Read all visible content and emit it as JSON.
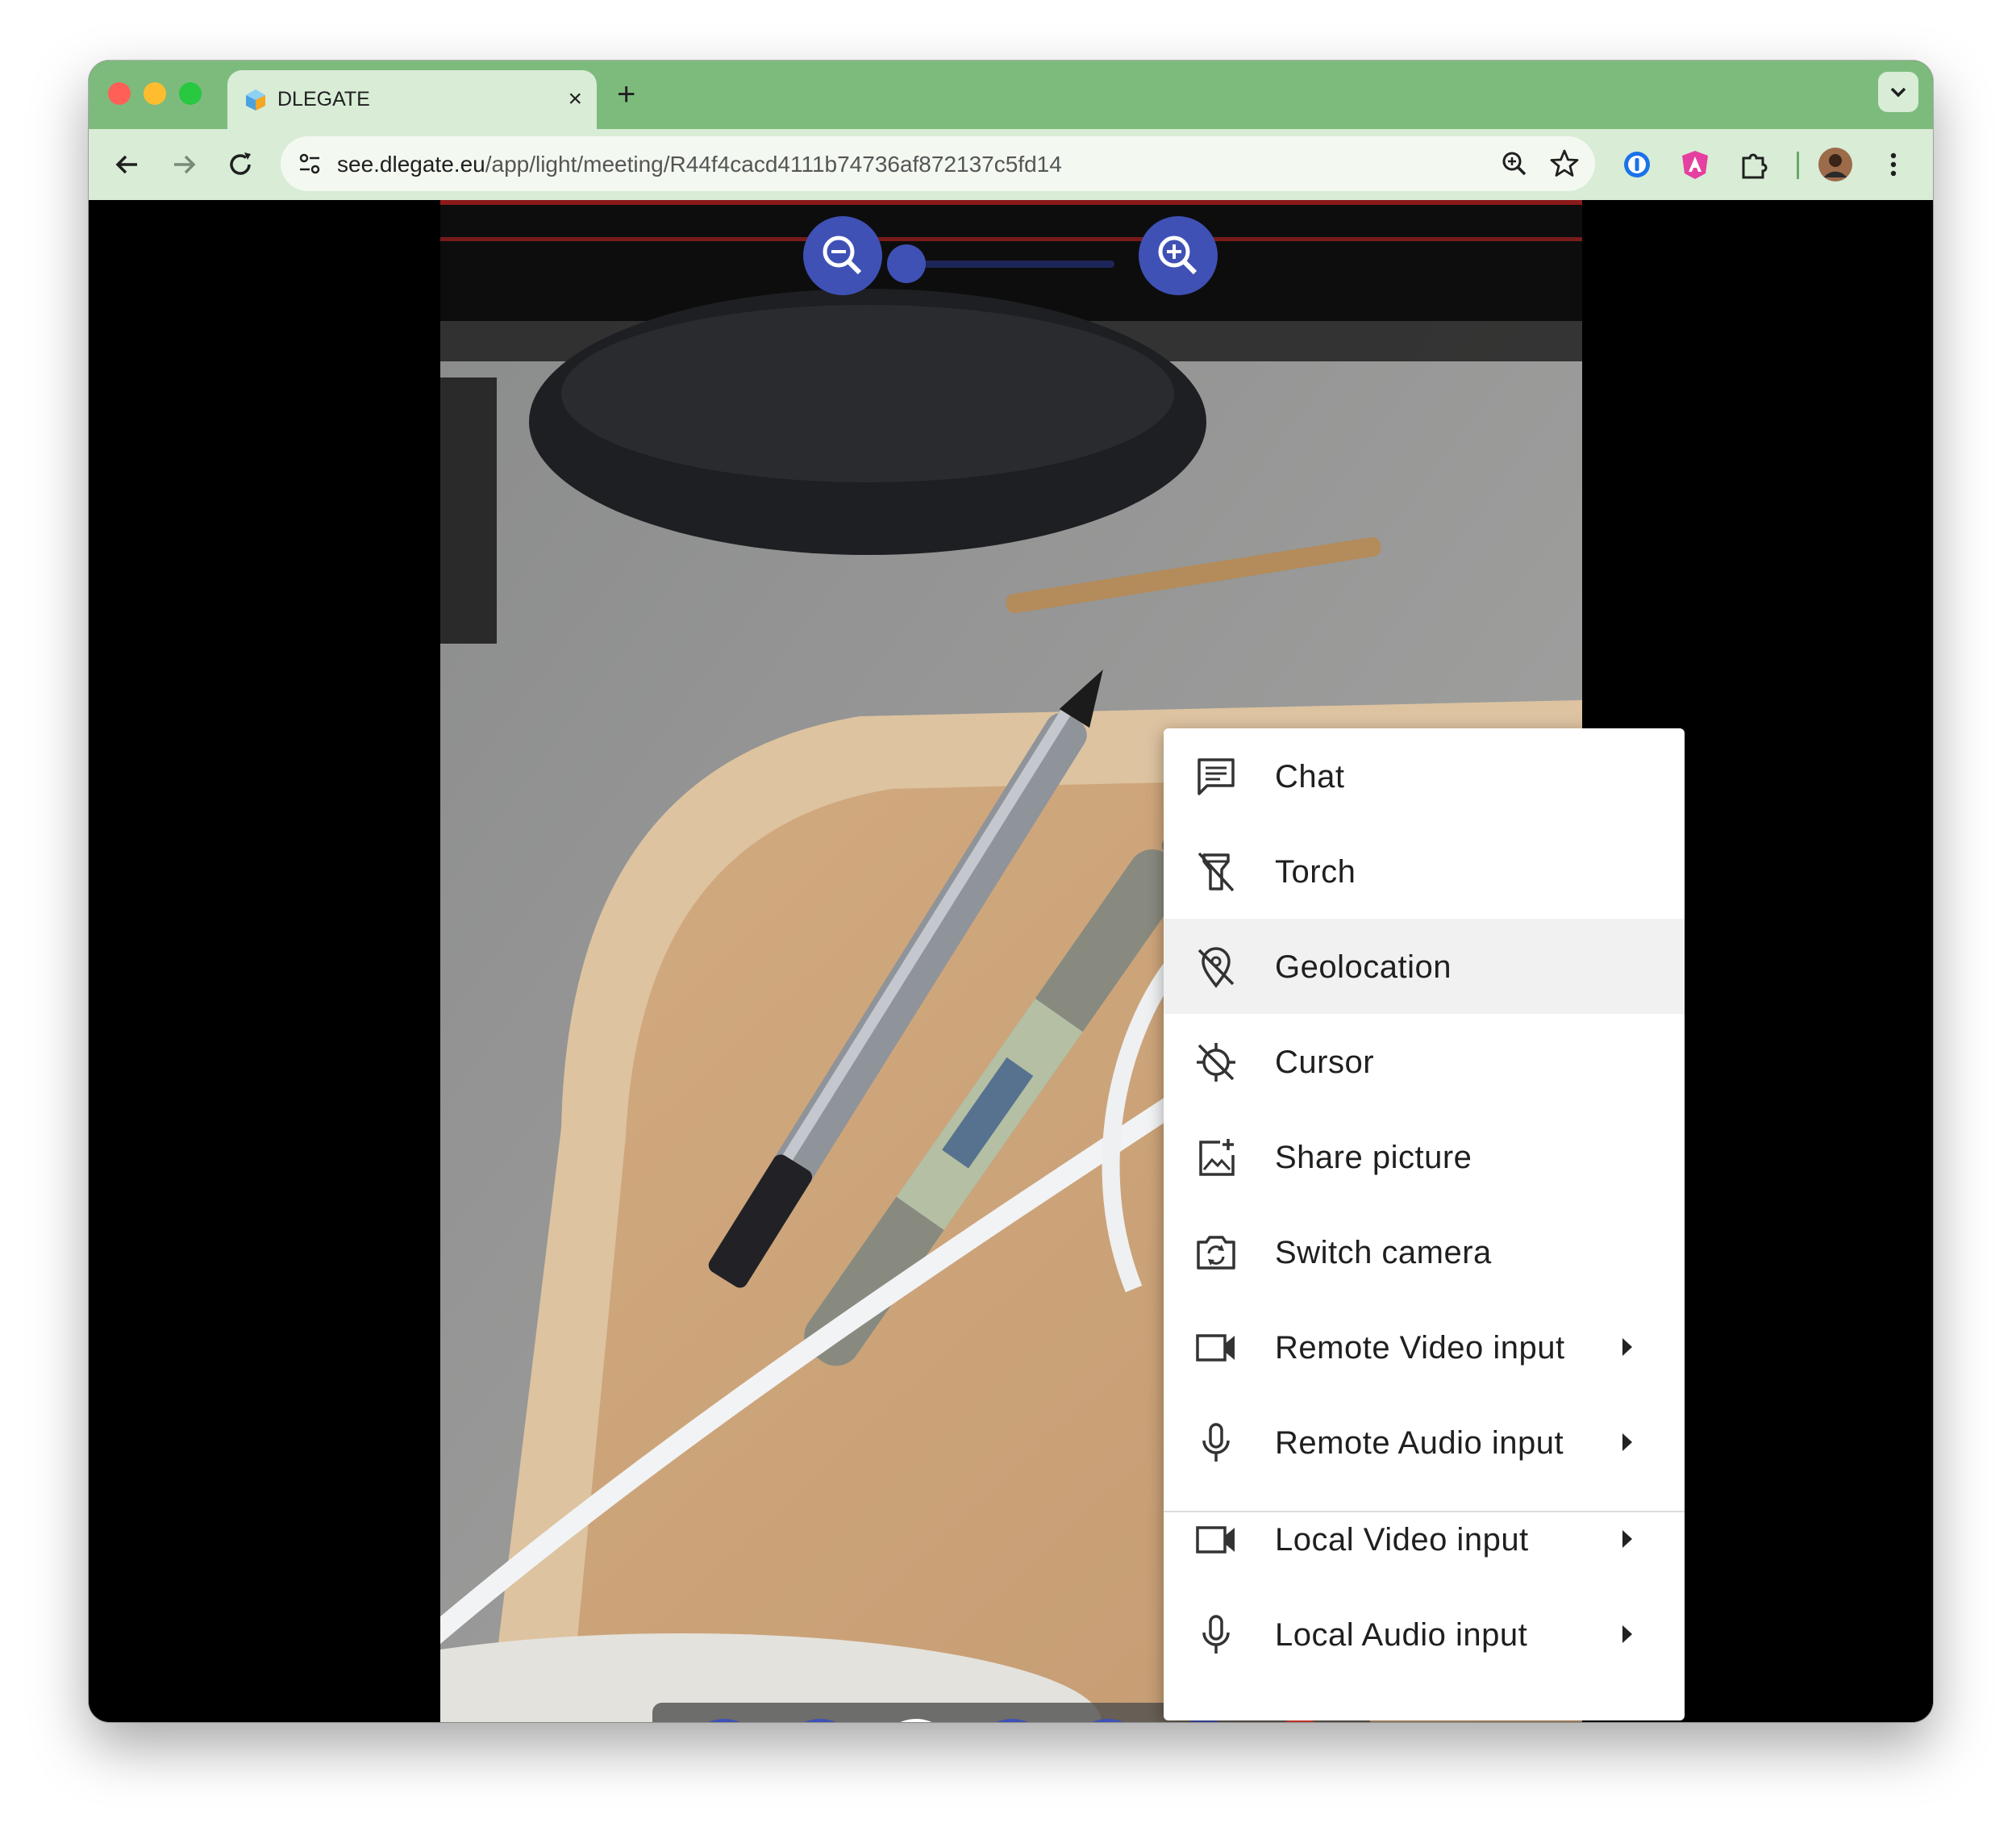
{
  "browser": {
    "tab": {
      "title": "DLEGATE",
      "close_glyph": "×"
    },
    "new_tab_glyph": "+",
    "url_host": "see.dlegate.eu",
    "url_path": "/app/light/meeting/R44f4cacd4111b74736af872137c5fd14"
  },
  "menu": {
    "items": [
      {
        "label": "Chat",
        "icon": "chat-icon"
      },
      {
        "label": "Torch",
        "icon": "torch-off-icon"
      },
      {
        "label": "Geolocation",
        "icon": "location-off-icon"
      },
      {
        "label": "Cursor",
        "icon": "gps-off-icon"
      },
      {
        "label": "Share picture",
        "icon": "add-photo-icon"
      },
      {
        "label": "Switch camera",
        "icon": "switch-camera-icon"
      },
      {
        "label": "Remote Video input",
        "icon": "videocam-icon"
      },
      {
        "label": "Remote Audio input",
        "icon": "mic-icon"
      },
      {
        "label": "Local Video input",
        "icon": "videocam-icon"
      },
      {
        "label": "Local Audio input",
        "icon": "mic-icon"
      }
    ]
  },
  "colors": {
    "tabstrip": "#7dbb7d",
    "toolbar": "#d8ecd6",
    "primary": "#3f51b5",
    "hangup": "#f44336"
  }
}
